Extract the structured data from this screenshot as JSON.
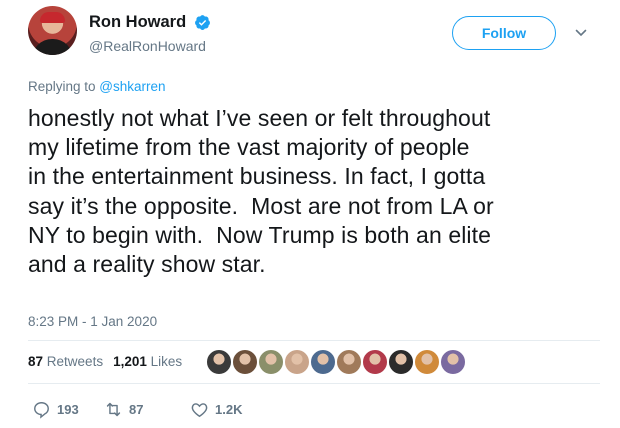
{
  "author": {
    "display_name": "Ron Howard",
    "handle": "@RealRonHoward",
    "verified_icon": "verified-badge-icon"
  },
  "follow_label": "Follow",
  "reply": {
    "prefix": "Replying to ",
    "mention": "@shkarren"
  },
  "tweet": {
    "text": "honestly not what I’ve seen or felt throughout\nmy lifetime from the vast majority of people\nin the entertainment business. In fact, I gotta\nsay it’s the opposite.  Most are not from LA or\nNY to begin with.  Now Trump is both an elite\nand a reality show star."
  },
  "timestamp": "8:23 PM - 1 Jan 2020",
  "stats": {
    "retweets_count": "87",
    "retweets_label": "Retweets",
    "likes_count": "1,201",
    "likes_label": "Likes"
  },
  "liker_avatars": [
    "#3a3a3a",
    "#6b4f3a",
    "#8a8f6a",
    "#c9a48a",
    "#4d6a8f",
    "#a07a5a",
    "#b23a4a",
    "#2b2b2b",
    "#d08a3a",
    "#7a6aa0"
  ],
  "actions": {
    "reply_count": "193",
    "retweet_count": "87",
    "like_count": "1.2K"
  },
  "colors": {
    "accent": "#1da1f2",
    "muted": "#657786",
    "text": "#14171a"
  }
}
